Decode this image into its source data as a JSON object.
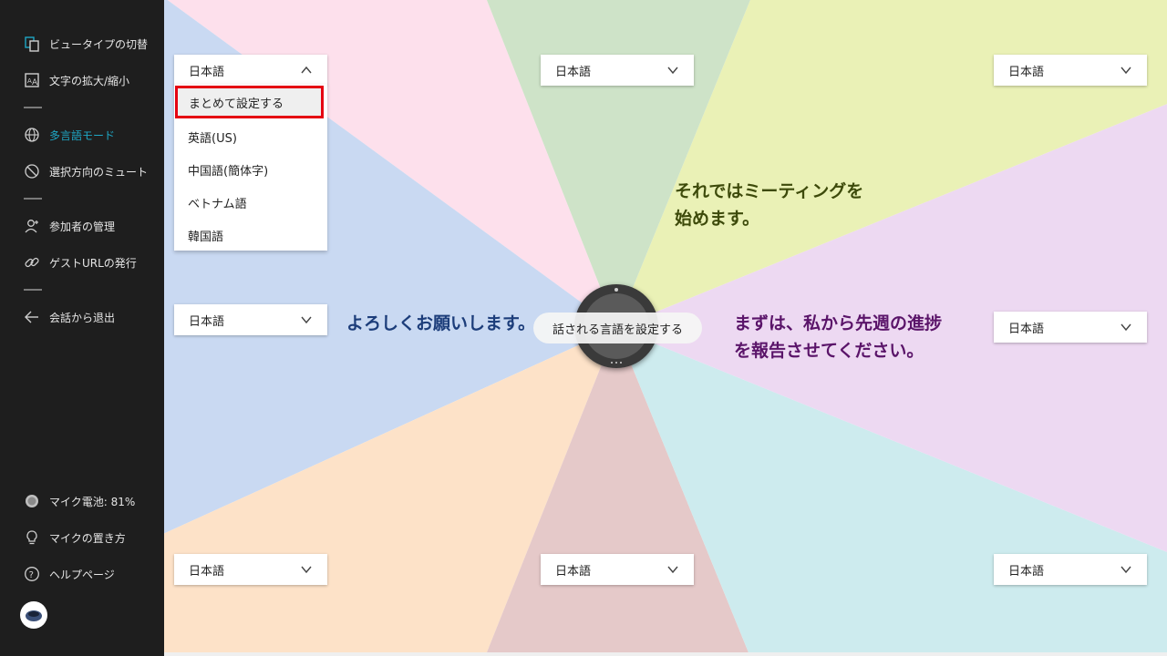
{
  "sidebar": {
    "items": [
      {
        "label": "ビュータイプの切替",
        "icon": "view-switch-icon"
      },
      {
        "label": "文字の拡大/縮小",
        "icon": "text-size-icon"
      },
      {
        "label": "多言語モード",
        "icon": "globe-icon"
      },
      {
        "label": "選択方向のミュート",
        "icon": "mute-direction-icon"
      },
      {
        "label": "参加者の管理",
        "icon": "person-icon"
      },
      {
        "label": "ゲストURLの発行",
        "icon": "link-icon"
      },
      {
        "label": "会話から退出",
        "icon": "arrow-left-icon"
      }
    ],
    "bottom": {
      "battery": "マイク電池: 81%",
      "placement": "マイクの置き方",
      "help": "ヘルプページ"
    },
    "active_color": "#1fa6c4"
  },
  "selectors": {
    "top_left": "日本語",
    "top_center": "日本語",
    "top_right": "日本語",
    "mid_left": "日本語",
    "mid_right": "日本語",
    "bottom_left": "日本語",
    "bottom_center": "日本語",
    "bottom_right": "日本語"
  },
  "dropdown": {
    "options": [
      "まとめて設定する",
      "英語(US)",
      "中国語(簡体字)",
      "ベトナム語",
      "韓国語"
    ],
    "highlight_color": "#e50012"
  },
  "utterances": {
    "left": "よろしくお願いします。",
    "top_right": [
      "それではミーティングを",
      "始めます。"
    ],
    "right": [
      "まずは、私から先週の進捗",
      "を報告させてください。"
    ]
  },
  "tooltip": "話される言語を設定する",
  "sector_colors": {
    "pink": "#fde0ec",
    "green": "#cee3c8",
    "yellow": "#eaf1b6",
    "lavender": "#edd9f2",
    "cyan": "#cdebee",
    "rose": "#e5c9c9",
    "peach": "#fde2c8",
    "blue": "#c9d9f2"
  },
  "text_colors": {
    "left": "#1c3d7a",
    "top_right": "#3d4a0a",
    "right": "#5a1469"
  }
}
